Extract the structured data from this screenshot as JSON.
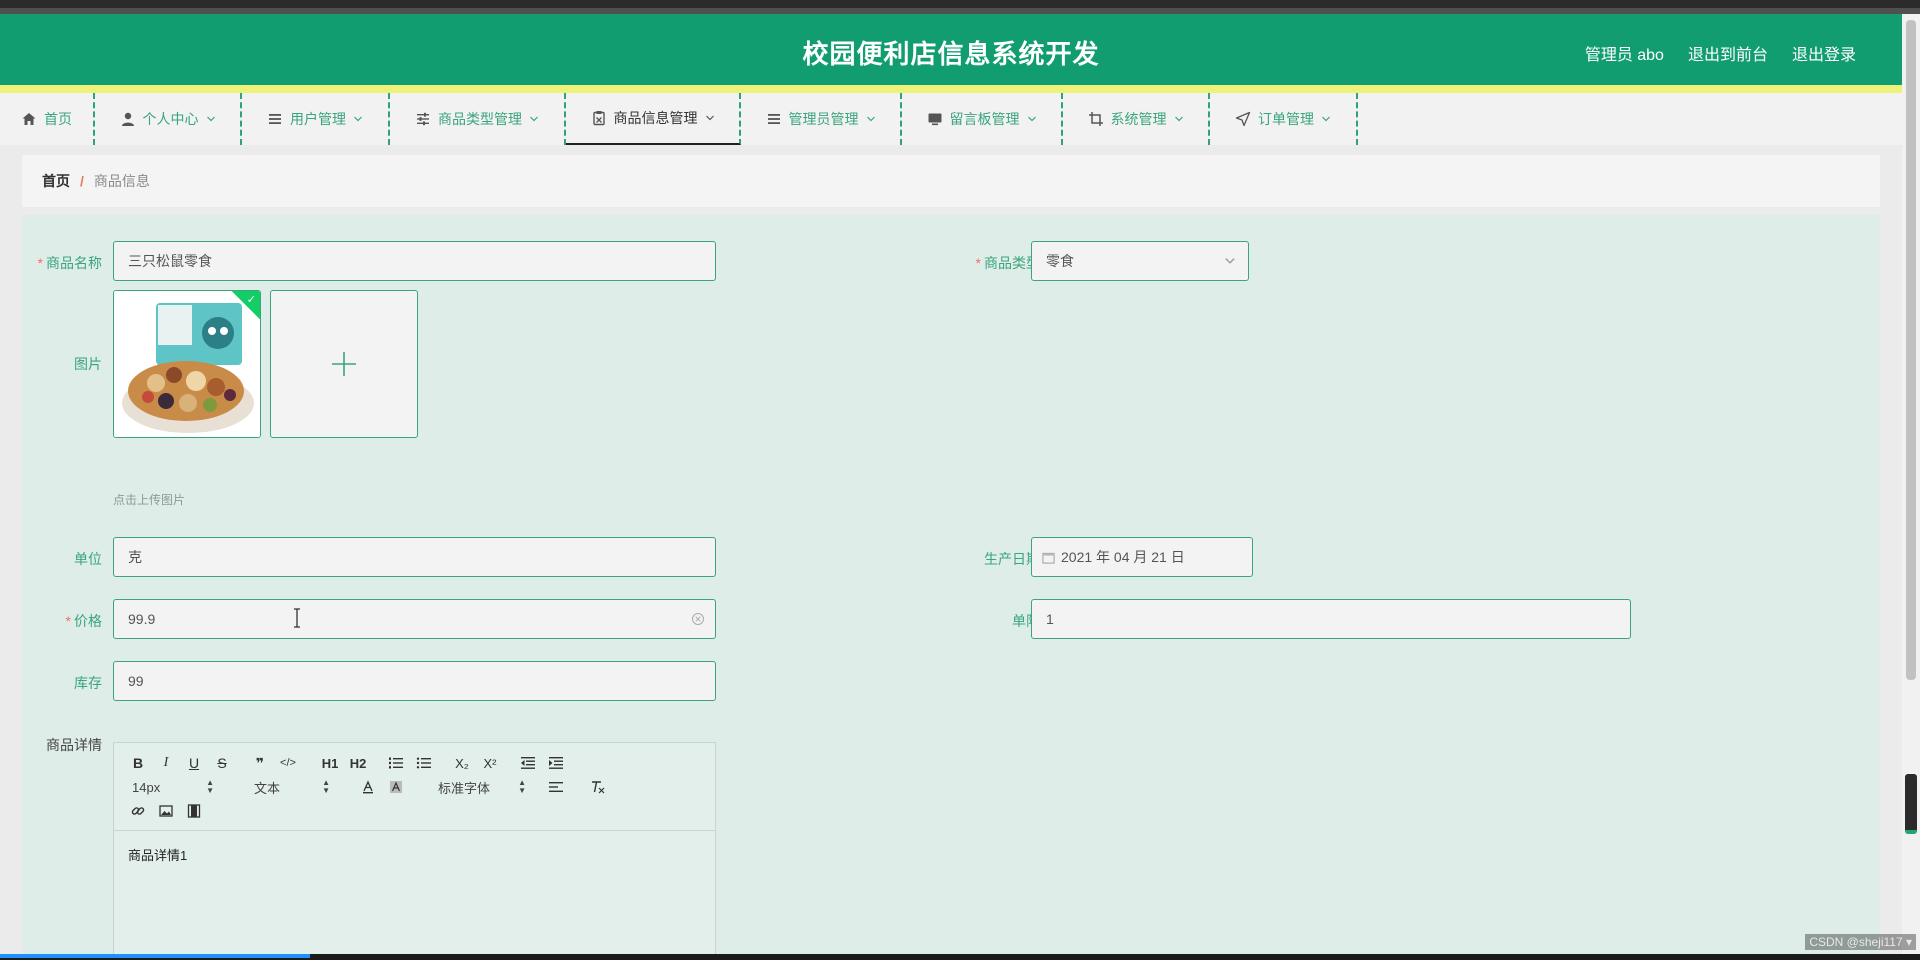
{
  "header": {
    "title": "校园便利店信息系统开发",
    "user": "管理员 abo",
    "to_front": "退出到前台",
    "logout": "退出登录"
  },
  "nav": {
    "items": [
      {
        "label": "首页",
        "icon": "home-icon",
        "has_dropdown": false
      },
      {
        "label": "个人中心",
        "icon": "user-icon",
        "has_dropdown": true
      },
      {
        "label": "用户管理",
        "icon": "list-icon",
        "has_dropdown": true
      },
      {
        "label": "商品类型管理",
        "icon": "sliders-icon",
        "has_dropdown": true
      },
      {
        "label": "商品信息管理",
        "icon": "clipboard-icon",
        "has_dropdown": true,
        "active": true
      },
      {
        "label": "管理员管理",
        "icon": "list-icon",
        "has_dropdown": true
      },
      {
        "label": "留言板管理",
        "icon": "monitor-icon",
        "has_dropdown": true
      },
      {
        "label": "系统管理",
        "icon": "crop-icon",
        "has_dropdown": true
      },
      {
        "label": "订单管理",
        "icon": "send-icon",
        "has_dropdown": true
      }
    ]
  },
  "breadcrumb": {
    "home": "首页",
    "sep": "/",
    "current": "商品信息"
  },
  "form": {
    "name_label": "商品名称",
    "name_value": "三只松鼠零食",
    "type_label": "商品类型",
    "type_value": "零食",
    "image_label": "图片",
    "upload_hint": "点击上传图片",
    "unit_label": "单位",
    "unit_value": "克",
    "date_label": "生产日期",
    "date_value": "2021 年 04 月 21 日",
    "price_label": "价格",
    "price_value": "99.9",
    "limit_label": "单限",
    "limit_value": "1",
    "stock_label": "库存",
    "stock_value": "99",
    "detail_label": "商品详情",
    "required_mark": "*"
  },
  "editor": {
    "row1": [
      "B",
      "I",
      "U",
      "S",
      "❞",
      "</>",
      "H1",
      "H2",
      "OL",
      "UL",
      "X₂",
      "X²",
      "outdent",
      "indent"
    ],
    "size_select": "14px",
    "text_select": "文本",
    "font_select": "标准字体",
    "content": "商品详情1"
  },
  "colors": {
    "header": "#119d70",
    "accent": "#3aa57d",
    "yellow": "#eef27a",
    "form_bg": "#deede8"
  },
  "watermark": "CSDN @sheji117 ▾"
}
